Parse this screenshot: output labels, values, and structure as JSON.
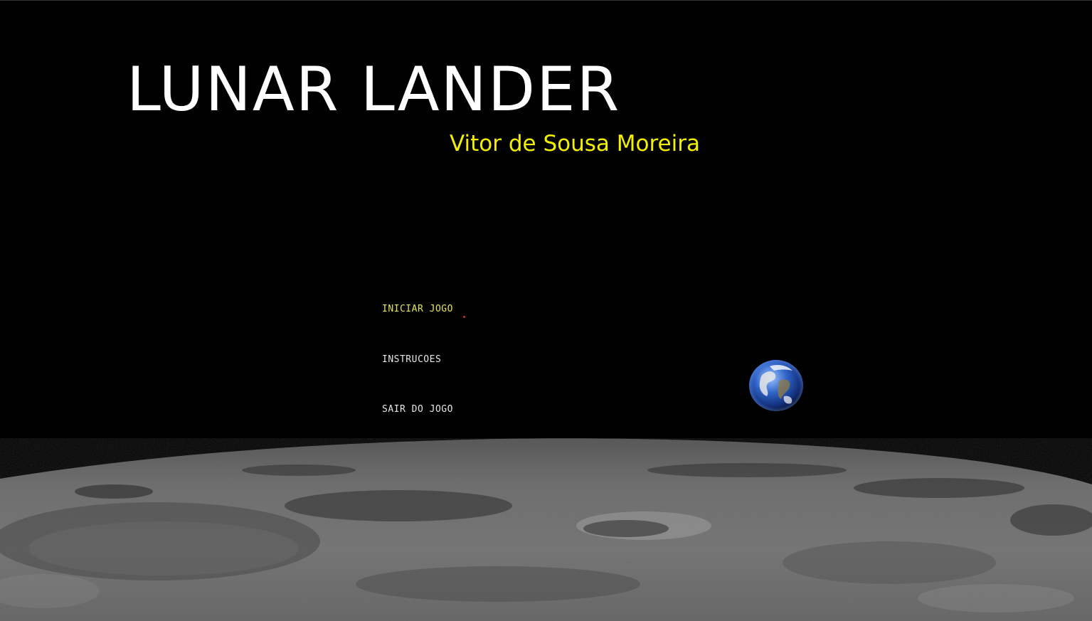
{
  "game": {
    "title": "LUNAR LANDER",
    "author": "Vitor de Sousa Moreira"
  },
  "menu": {
    "items": [
      {
        "label": "INICIAR JOGO",
        "selected": true
      },
      {
        "label": "INSTRUCOES",
        "selected": false
      },
      {
        "label": "SAIR DO JOGO",
        "selected": false
      }
    ]
  },
  "scene": {
    "background": "#000000",
    "title_color": "#ffffff",
    "author_color": "#f2f000",
    "selected_color": "#e8e25a",
    "menu_color": "#e6e6e6",
    "planet": "earth",
    "terrain": "lunar-surface"
  }
}
